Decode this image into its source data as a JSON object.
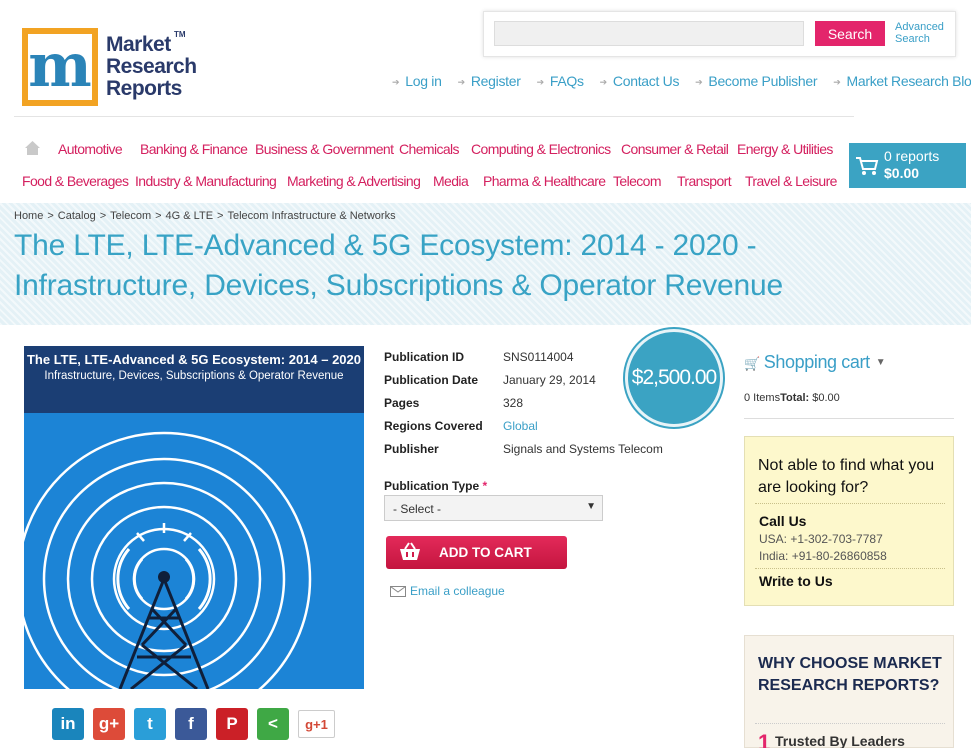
{
  "logo": {
    "line1": "Market",
    "line2": "Research",
    "line3": "Reports",
    "tm": "TM",
    "letter": "m"
  },
  "search": {
    "button": "Search",
    "advanced_line1": "Advanced",
    "advanced_line2": "Search",
    "placeholder": ""
  },
  "top_links": [
    "Log in",
    "Register",
    "FAQs",
    "Contact Us",
    "Become Publisher",
    "Market Research Blog"
  ],
  "categories_row1": [
    "Automotive",
    "Banking & Finance",
    "Business & Government",
    "Chemicals",
    "Computing & Electronics",
    "Consumer & Retail",
    "Energy & Utilities"
  ],
  "categories_row2": [
    "Food & Beverages",
    "Industry & Manufacturing",
    "Marketing & Advertising",
    "Media",
    "Pharma & Healthcare",
    "Telecom",
    "Transport",
    "Travel & Leisure"
  ],
  "cart": {
    "reports": "0 reports",
    "total": "$0.00"
  },
  "breadcrumb": [
    "Home",
    "Catalog",
    "Telecom",
    "4G & LTE",
    "Telecom Infrastructure & Networks"
  ],
  "breadcrumb_sep": ">",
  "title_line1": "The LTE, LTE-Advanced & 5G Ecosystem: 2014 - 2020 -",
  "title_line2": "Infrastructure, Devices, Subscriptions & Operator Revenue",
  "cover": {
    "title": "The LTE, LTE-Advanced & 5G Ecosystem: 2014 – 2020",
    "subtitle": "Infrastructure, Devices, Subscriptions & Operator Revenue"
  },
  "details": [
    {
      "label": "Publication ID",
      "value": "SNS0114004",
      "link": false
    },
    {
      "label": "Publication Date",
      "value": "January 29, 2014",
      "link": false
    },
    {
      "label": "Pages",
      "value": "328",
      "link": false
    },
    {
      "label": "Regions Covered",
      "value": "Global",
      "link": true
    },
    {
      "label": "Publisher",
      "value": "Signals and Systems Telecom",
      "link": false
    }
  ],
  "price": "$2,500.00",
  "publication_type": {
    "label": "Publication Type",
    "required_mark": "*",
    "selected": "- Select -"
  },
  "add_to_cart": "ADD TO CART",
  "email_colleague": "Email a colleague",
  "social": [
    "in",
    "g+",
    "twitter",
    "f",
    "P",
    "share",
    "g+1"
  ],
  "social_glyphs": {
    "linkedin": "in",
    "googleplus": "g+",
    "twitter": "t",
    "facebook": "f",
    "pinterest": "P",
    "share": "<",
    "gplus1": "g+1"
  },
  "sidebar": {
    "cart_title": "Shopping cart",
    "items_label": "0 Items",
    "total_label": "Total:",
    "total_value": "$0.00",
    "help_question": "Not able to find what you are looking for?",
    "call_us": "Call Us",
    "usa": "USA: +1-302-703-7787",
    "india": "India: +91-80-26860858",
    "write_to_us": "Write to Us",
    "why_title": "WHY CHOOSE MARKET RESEARCH REPORTS?",
    "why_item_number": "1",
    "why_item": "Trusted By Leaders"
  },
  "colors": {
    "accent_pink": "#e3256b",
    "accent_blue": "#3ba3c3",
    "title_blue": "#38a3c5",
    "logo_orange": "#f2a323",
    "help_yellow": "#fdf8cc"
  }
}
